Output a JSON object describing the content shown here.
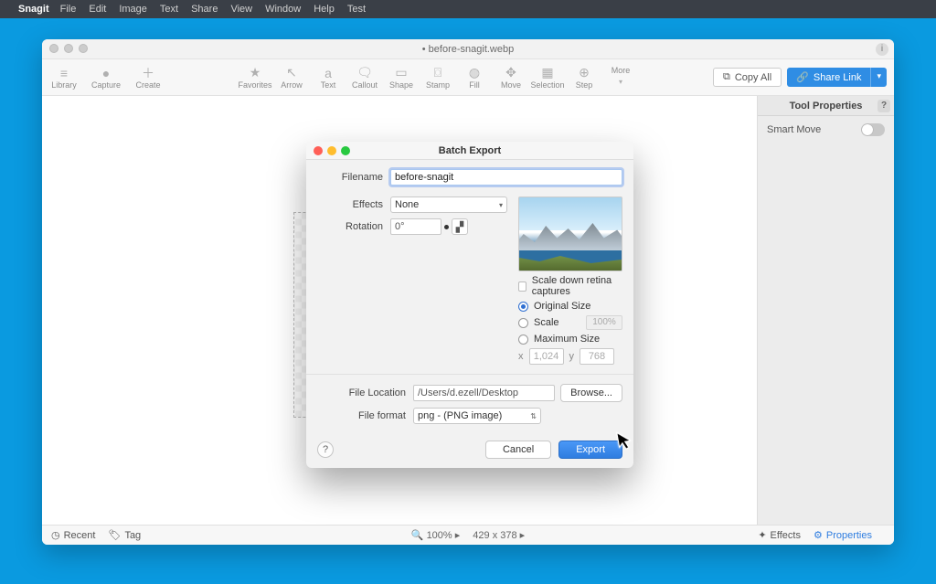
{
  "menubar": {
    "app": "Snagit",
    "items": [
      "File",
      "Edit",
      "Image",
      "Text",
      "Share",
      "View",
      "Window",
      "Help",
      "Test"
    ]
  },
  "window": {
    "title": "• before-snagit.webp",
    "toolbar_left": [
      {
        "icon": "menu-icon",
        "label": "Library"
      },
      {
        "icon": "dot-icon",
        "label": "Capture"
      },
      {
        "icon": "plus-icon",
        "label": "Create"
      }
    ],
    "toolbar_center": [
      {
        "icon": "star-icon",
        "label": "Favorites"
      },
      {
        "icon": "arrow-icon",
        "label": "Arrow"
      },
      {
        "icon": "text-icon",
        "label": "Text"
      },
      {
        "icon": "callout-icon",
        "label": "Callout"
      },
      {
        "icon": "shape-icon",
        "label": "Shape"
      },
      {
        "icon": "stamp-icon",
        "label": "Stamp"
      },
      {
        "icon": "fill-icon",
        "label": "Fill"
      },
      {
        "icon": "move-icon",
        "label": "Move"
      },
      {
        "icon": "selection-icon",
        "label": "Selection"
      },
      {
        "icon": "step-icon",
        "label": "Step"
      }
    ],
    "more_label": "More",
    "copy_all": "Copy All",
    "share_link": "Share Link"
  },
  "side_panel": {
    "title": "Tool Properties",
    "smart_move": "Smart Move"
  },
  "statusbar": {
    "recent": "Recent",
    "tag": "Tag",
    "zoom": "100% ",
    "dims": "429 x 378 ",
    "effects": "Effects",
    "properties": "Properties"
  },
  "dialog": {
    "title": "Batch Export",
    "filename_label": "Filename",
    "filename_value": "before-snagit",
    "effects_label": "Effects",
    "effects_value": "None",
    "rotation_label": "Rotation",
    "rotation_value": "0°",
    "scale_down": "Scale down retina captures",
    "original_size": "Original Size",
    "scale": "Scale",
    "scale_pct": "100%",
    "max_size": "Maximum Size",
    "x_label": "x",
    "x_value": "1,024",
    "y_label": "y",
    "y_value": "768",
    "file_location_label": "File Location",
    "file_location_value": "/Users/d.ezell/Desktop",
    "browse": "Browse...",
    "file_format_label": "File format",
    "file_format_value": "png - (PNG image)",
    "cancel": "Cancel",
    "export": "Export"
  }
}
